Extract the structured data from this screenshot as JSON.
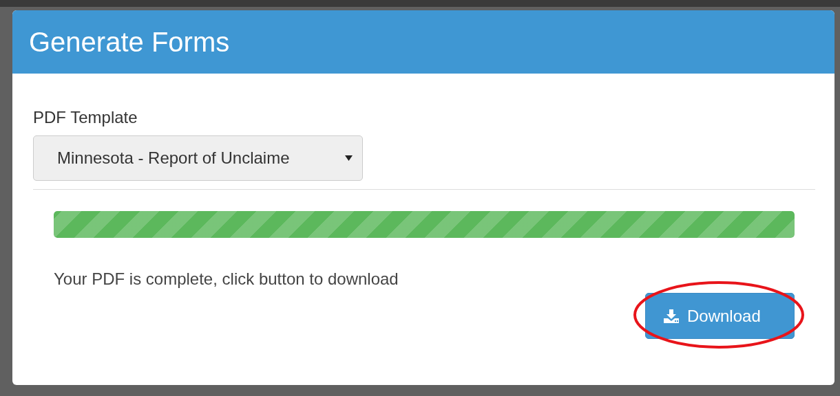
{
  "dialog": {
    "title": "Generate Forms"
  },
  "template": {
    "label": "PDF Template",
    "value": "Minnesota - Report of Unclaime"
  },
  "progress": {
    "level": 1
  },
  "message": "Your PDF is complete, click button to download",
  "download_button": {
    "label": "Download"
  },
  "annotation": {
    "kind": "ellipse"
  }
}
